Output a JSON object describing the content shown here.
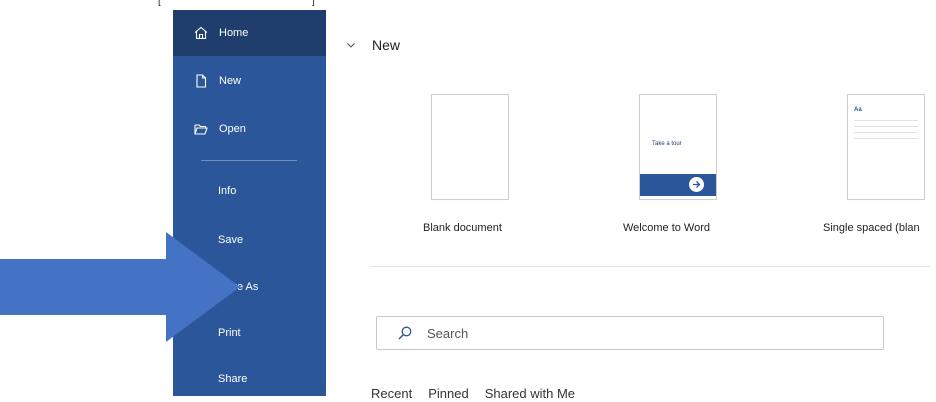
{
  "sidebar": {
    "items": [
      {
        "label": "Home",
        "icon": "home-icon",
        "active": true
      },
      {
        "label": "New",
        "icon": "new-document-icon"
      },
      {
        "label": "Open",
        "icon": "open-folder-icon"
      },
      {
        "label": "Info"
      },
      {
        "label": "Save"
      },
      {
        "label": "Save As"
      },
      {
        "label": "Print"
      },
      {
        "label": "Share"
      }
    ]
  },
  "main": {
    "section_title": "New",
    "templates": [
      {
        "label": "Blank document"
      },
      {
        "label": "Welcome to Word",
        "thumb_text": "Take a tour"
      },
      {
        "label": "Single spaced (blan",
        "thumb_text": "Aa"
      }
    ],
    "search": {
      "placeholder": "Search"
    },
    "tabs": [
      "Recent",
      "Pinned",
      "Shared with Me"
    ]
  },
  "colors": {
    "sidebar": "#2b579a",
    "sidebar_active": "#1f3e6e",
    "arrow": "#4472c4"
  }
}
